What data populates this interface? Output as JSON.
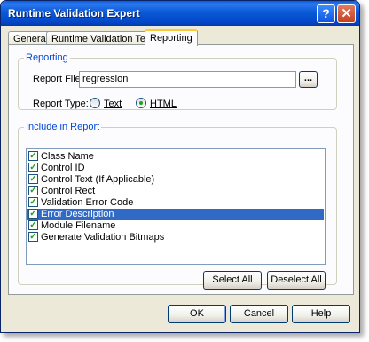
{
  "window": {
    "title": "Runtime Validation Expert",
    "help_glyph": "?",
    "close_glyph": "✕"
  },
  "tabs": [
    {
      "label": "General",
      "active": false
    },
    {
      "label": "Runtime Validation Tests",
      "active": false
    },
    {
      "label": "Reporting",
      "active": true
    }
  ],
  "reporting": {
    "legend": "Reporting",
    "file_label": "Report File:",
    "file_value": "regression",
    "browse_label": "...",
    "type_label": "Report Type:",
    "types": [
      {
        "label": "Text",
        "selected": false
      },
      {
        "label": "HTML",
        "selected": true
      }
    ]
  },
  "include": {
    "legend": "Include in Report",
    "items": [
      {
        "label": "Class Name",
        "checked": true,
        "selected": false
      },
      {
        "label": "Control ID",
        "checked": true,
        "selected": false
      },
      {
        "label": "Control Text (If Applicable)",
        "checked": true,
        "selected": false
      },
      {
        "label": "Control Rect",
        "checked": true,
        "selected": false
      },
      {
        "label": "Validation Error Code",
        "checked": true,
        "selected": false
      },
      {
        "label": "Error Description",
        "checked": true,
        "selected": true
      },
      {
        "label": "Module Filename",
        "checked": true,
        "selected": false
      },
      {
        "label": "Generate Validation Bitmaps",
        "checked": true,
        "selected": false
      }
    ],
    "select_all_label": "Select All",
    "deselect_all_label": "Deselect All"
  },
  "footer": {
    "ok_label": "OK",
    "cancel_label": "Cancel",
    "help_label": "Help"
  },
  "check_glyph": "✓"
}
